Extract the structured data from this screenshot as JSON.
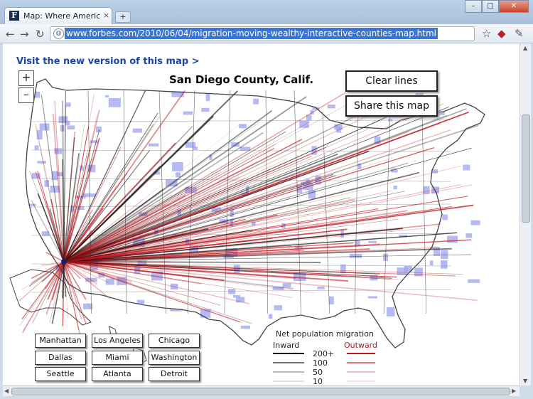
{
  "browser": {
    "tab_title": "Map: Where Americans Are",
    "tab_close": "×",
    "new_tab": "+",
    "url": "www.forbes.com/2010/06/04/migration-moving-wealthy-interactive-counties-map.html",
    "window_minimize": "–",
    "window_maximize": "□",
    "window_close": "✕"
  },
  "page": {
    "visit_link": "Visit the new version of this map >",
    "zoom_in": "+",
    "zoom_out": "–",
    "map_title": "San Diego County, Calif.",
    "clear_lines": "Clear lines",
    "share_map": "Share this map",
    "cities": [
      "Manhattan",
      "Los Angeles",
      "Chicago",
      "Dallas",
      "Miami",
      "Washington",
      "Seattle",
      "Atlanta",
      "Detroit"
    ]
  },
  "legend": {
    "title": "Net population migration",
    "inward": "Inward",
    "outward": "Outward",
    "values": [
      "200+",
      "100",
      "50",
      "10"
    ]
  },
  "colors": {
    "inward_line": "#111111",
    "outward_line": "#c0141c",
    "highlight_county": "#9da3ef",
    "link": "#1846a7"
  }
}
